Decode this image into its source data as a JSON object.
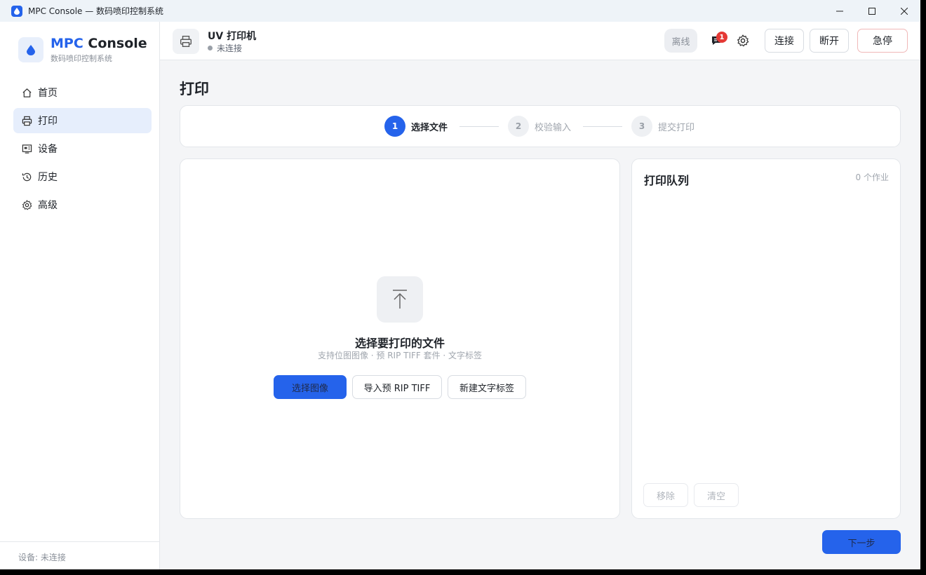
{
  "window": {
    "title": "MPC Console — 数码喷印控制系统"
  },
  "brand": {
    "name_accent": "MPC",
    "name_rest": "Console",
    "subtitle": "数码喷印控制系统"
  },
  "nav": {
    "items": [
      {
        "label": "首页",
        "icon": "home-icon"
      },
      {
        "label": "打印",
        "icon": "printer-icon",
        "active": true
      },
      {
        "label": "设备",
        "icon": "device-icon"
      },
      {
        "label": "历史",
        "icon": "history-icon"
      },
      {
        "label": "高级",
        "icon": "gear-icon"
      }
    ]
  },
  "sidebar_footer": "设备: 未连接",
  "header": {
    "device_name": "UV 打印机",
    "device_status": "未连接",
    "offline_label": "离线",
    "notification_count": "1",
    "connect_label": "连接",
    "disconnect_label": "断开",
    "estop_label": "急停"
  },
  "page": {
    "title": "打印"
  },
  "stepper": {
    "steps": [
      {
        "num": "1",
        "label": "选择文件",
        "active": true
      },
      {
        "num": "2",
        "label": "校验输入"
      },
      {
        "num": "3",
        "label": "提交打印"
      }
    ]
  },
  "upload": {
    "title": "选择要打印的文件",
    "subtitle": "支持位图图像 · 预 RIP TIFF 套件 · 文字标签",
    "select_image": "选择图像",
    "import_tiff": "导入预 RIP TIFF",
    "new_label": "新建文字标签"
  },
  "queue": {
    "title": "打印队列",
    "count": "0 个作业",
    "remove": "移除",
    "clear": "清空"
  },
  "footer": {
    "next": "下一步"
  },
  "colors": {
    "accent": "#2563eb",
    "danger": "#e53935"
  }
}
